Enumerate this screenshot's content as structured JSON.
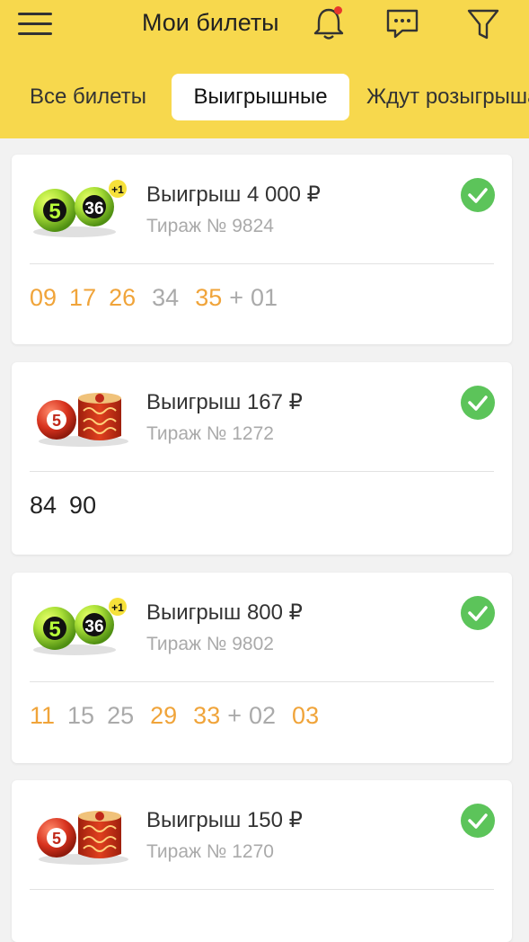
{
  "header": {
    "title": "Мои билеты",
    "icons": [
      "menu-icon",
      "bell-icon",
      "chat-icon",
      "filter-icon"
    ],
    "bell_has_notification": true
  },
  "tabs": [
    {
      "label": "Все билеты",
      "active": false
    },
    {
      "label": "Выигрышные",
      "active": true
    },
    {
      "label": "Ждут розыгрыша",
      "active": false
    }
  ],
  "tickets": [
    {
      "game": "5 из 36",
      "win": "Выигрыш 4 000 ₽",
      "draw": "Тираж № 9824",
      "numbers": [
        {
          "v": "09",
          "state": "hit"
        },
        {
          "v": "17",
          "state": "hit"
        },
        {
          "v": "26",
          "state": "hit"
        },
        {
          "v": "34",
          "state": "miss"
        },
        {
          "v": "35",
          "state": "hit"
        },
        {
          "v": "+",
          "state": "sep"
        },
        {
          "v": "01",
          "state": "miss"
        }
      ]
    },
    {
      "game": "Бинго",
      "win": "Выигрыш 167 ₽",
      "draw": "Тираж № 1272",
      "numbers": [
        {
          "v": "84",
          "state": "plain"
        },
        {
          "v": "90",
          "state": "plain"
        }
      ]
    },
    {
      "game": "5 из 36",
      "win": "Выигрыш 800 ₽",
      "draw": "Тираж № 9802",
      "numbers": [
        {
          "v": "11",
          "state": "hit"
        },
        {
          "v": "15",
          "state": "miss"
        },
        {
          "v": "25",
          "state": "miss"
        },
        {
          "v": "29",
          "state": "hit"
        },
        {
          "v": "33",
          "state": "hit"
        },
        {
          "v": "+",
          "state": "sep"
        },
        {
          "v": "02",
          "state": "miss"
        },
        {
          "v": "03",
          "state": "hit"
        }
      ]
    },
    {
      "game": "Бинго",
      "win": "Выигрыш 150 ₽",
      "draw": "Тираж № 1270",
      "numbers": []
    }
  ],
  "colors": {
    "header_bg": "#f7d84d",
    "hit": "#f0a43a",
    "miss": "#aaaaaa",
    "check": "#5cc45a"
  }
}
